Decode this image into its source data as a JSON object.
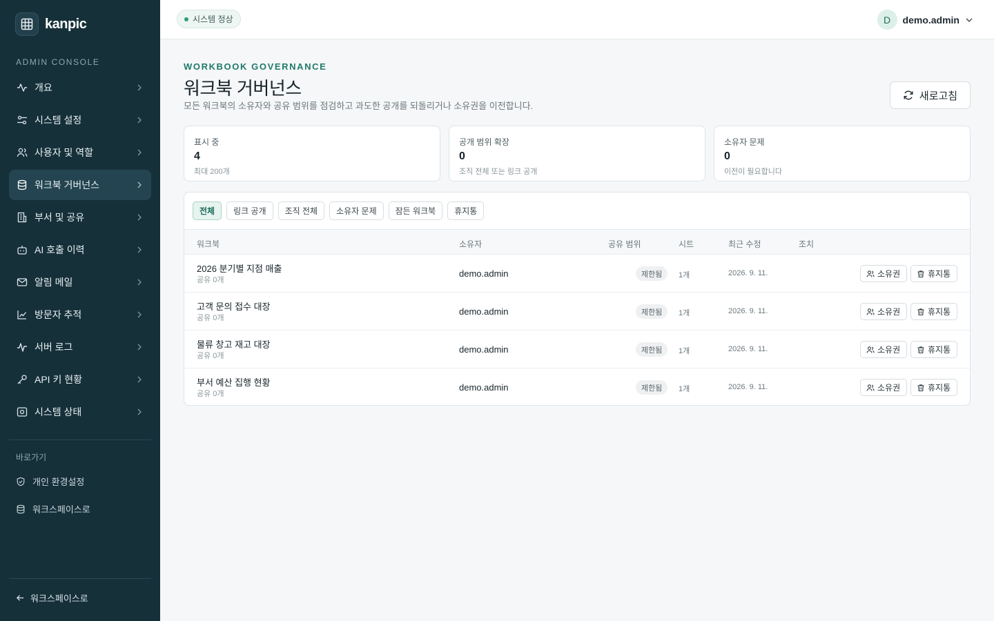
{
  "sidebar": {
    "brand": "kanpic",
    "section_label": "ADMIN CONSOLE",
    "items": [
      {
        "label": "개요",
        "icon": "activity-icon"
      },
      {
        "label": "시스템 설정",
        "icon": "sliders-icon"
      },
      {
        "label": "사용자 및 역할",
        "icon": "users-icon"
      },
      {
        "label": "워크북 거버넌스",
        "icon": "database-icon",
        "active": true
      },
      {
        "label": "부서 및 공유",
        "icon": "building-icon"
      },
      {
        "label": "AI 호출 이력",
        "icon": "bot-icon"
      },
      {
        "label": "알림 메일",
        "icon": "mail-icon"
      },
      {
        "label": "방문자 추적",
        "icon": "chart-line-icon"
      },
      {
        "label": "서버 로그",
        "icon": "pulse-icon"
      },
      {
        "label": "API 키 현황",
        "icon": "key-icon"
      },
      {
        "label": "시스템 상태",
        "icon": "status-icon"
      }
    ],
    "shortcut_label": "바로가기",
    "shortcuts": [
      {
        "label": "개인 환경설정",
        "icon": "shield-icon"
      },
      {
        "label": "워크스페이스로",
        "icon": "database-icon"
      }
    ],
    "back_label": "워크스페이스로"
  },
  "topbar": {
    "status": "시스템 정상",
    "user_initial": "D",
    "user_name": "demo.admin"
  },
  "header": {
    "eyebrow": "WORKBOOK GOVERNANCE",
    "title": "워크북 거버넌스",
    "description": "모든 워크북의 소유자와 공유 범위를 점검하고 과도한 공개를 되돌리거나 소유권을 이전합니다.",
    "refresh_label": "새로고침"
  },
  "stats": [
    {
      "title": "표시 중",
      "value": "4",
      "sub": "최대 200개"
    },
    {
      "title": "공개 범위 확장",
      "value": "0",
      "sub": "조직 전체 또는 링크 공개"
    },
    {
      "title": "소유자 문제",
      "value": "0",
      "sub": "이전이 필요합니다"
    }
  ],
  "filters": [
    "전체",
    "링크 공개",
    "조직 전체",
    "소유자 문제",
    "잠든 워크북",
    "휴지통"
  ],
  "table": {
    "headers": {
      "workbook": "워크북",
      "owner": "소유자",
      "scope": "공유 범위",
      "sheets": "시트",
      "modified": "최근 수정",
      "actions": "조치"
    },
    "rows": [
      {
        "name": "2026 분기별 지점 매출",
        "sub": "공유 0개",
        "owner": "demo.admin",
        "scope": "제한됨",
        "sheets": "1개",
        "modified": "2026. 9. 11."
      },
      {
        "name": "고객 문의 접수 대장",
        "sub": "공유 0개",
        "owner": "demo.admin",
        "scope": "제한됨",
        "sheets": "1개",
        "modified": "2026. 9. 11."
      },
      {
        "name": "물류 창고 재고 대장",
        "sub": "공유 0개",
        "owner": "demo.admin",
        "scope": "제한됨",
        "sheets": "1개",
        "modified": "2026. 9. 11."
      },
      {
        "name": "부서 예산 집행 현황",
        "sub": "공유 0개",
        "owner": "demo.admin",
        "scope": "제한됨",
        "sheets": "1개",
        "modified": "2026. 9. 11."
      }
    ],
    "action_owner": "소유권",
    "action_trash": "휴지통"
  }
}
